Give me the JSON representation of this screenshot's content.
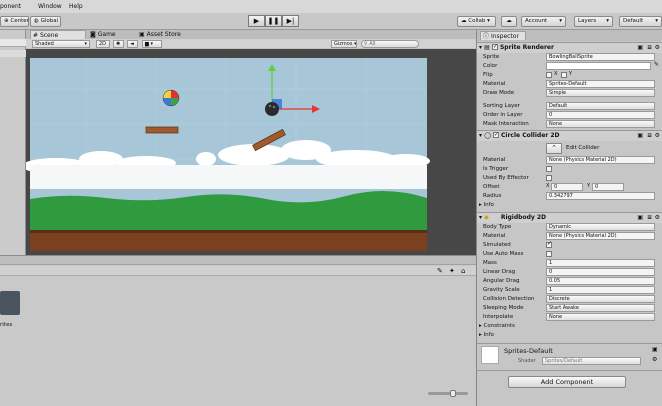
{
  "menu": {
    "component": "ponent",
    "window": "Window",
    "help": "Help"
  },
  "toolbar": {
    "center": "Center",
    "global": "Global",
    "play": "▶",
    "pause": "❚❚",
    "step": "▶|",
    "collab": "Collab ▾",
    "account": "Account",
    "layers": "Layers",
    "layout": "Default"
  },
  "scene": {
    "tabs": {
      "scene": "Scene",
      "game": "Game",
      "asset_store": "Asset Store"
    },
    "shading": "Shaded",
    "mode2d": "2D",
    "gizmos": "Gizmos ▾",
    "search_placeholder": "All"
  },
  "project": {
    "folder_label": "rites"
  },
  "inspector": {
    "tab": "Inspector",
    "sprite_renderer": {
      "title": "Sprite Renderer",
      "sprite_label": "Sprite",
      "sprite_value": "BowlingBallSprite",
      "color_label": "Color",
      "flip_label": "Flip",
      "flip_x": "X",
      "flip_y": "Y",
      "material_label": "Material",
      "material_value": "Sprites-Default",
      "draw_mode_label": "Draw Mode",
      "draw_mode_value": "Simple",
      "sorting_layer_label": "Sorting Layer",
      "sorting_layer_value": "Default",
      "order_label": "Order in Layer",
      "order_value": "0",
      "mask_label": "Mask Interaction",
      "mask_value": "None"
    },
    "circle_collider": {
      "title": "Circle Collider 2D",
      "edit_collider": "Edit Collider",
      "material_label": "Material",
      "material_value": "None (Physics Material 2D)",
      "is_trigger_label": "Is Trigger",
      "used_by_effector_label": "Used By Effector",
      "offset_label": "Offset",
      "offset_x_label": "X",
      "offset_x": "0",
      "offset_y_label": "Y",
      "offset_y": "0",
      "radius_label": "Radius",
      "radius_value": "0.342797",
      "info_label": "Info"
    },
    "rigidbody": {
      "title": "Rigidbody 2D",
      "body_type_label": "Body Type",
      "body_type_value": "Dynamic",
      "material_label": "Material",
      "material_value": "None (Physics Material 2D)",
      "simulated_label": "Simulated",
      "simulated": true,
      "use_auto_mass_label": "Use Auto Mass",
      "use_auto_mass": false,
      "mass_label": "Mass",
      "mass_value": "1",
      "linear_drag_label": "Linear Drag",
      "linear_drag_value": "0",
      "angular_drag_label": "Angular Drag",
      "angular_drag_value": "0.05",
      "gravity_label": "Gravity Scale",
      "gravity_value": "1",
      "collision_label": "Collision Detection",
      "collision_value": "Discrete",
      "sleeping_label": "Sleeping Mode",
      "sleeping_value": "Start Awake",
      "interpolate_label": "Interpolate",
      "interpolate_value": "None",
      "constraints_label": "Constraints",
      "info_label": "Info"
    },
    "material_preview": {
      "name": "Sprites-Default",
      "shader_label": "Shader",
      "shader_value": "Sprites/Default"
    },
    "add_component": "Add Component"
  },
  "colors": {
    "sky": "#a7c7d8",
    "grass": "#2f9a3e",
    "dirt": "#7a4020",
    "gizmo_x": "#e8352e",
    "gizmo_y": "#5fce3f",
    "gizmo_z": "#3b6fd8"
  }
}
